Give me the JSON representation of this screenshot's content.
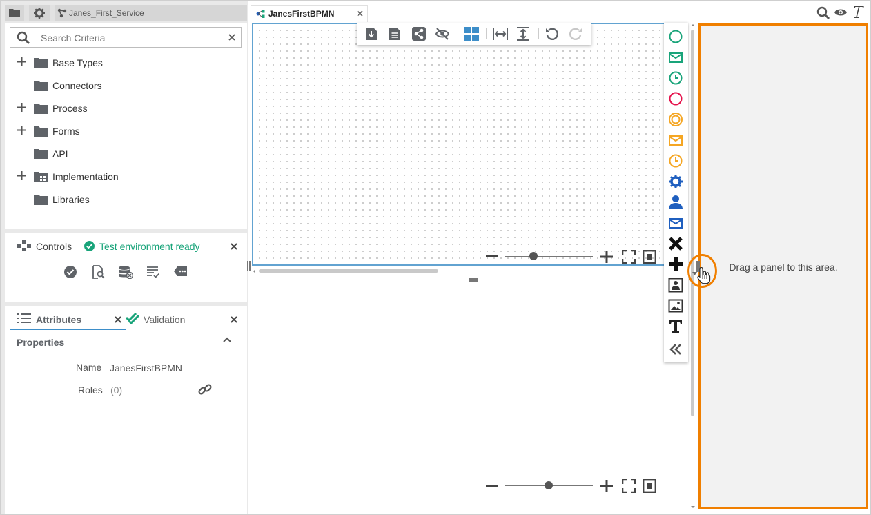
{
  "topbar": {
    "project_name": "Janes_First_Service"
  },
  "search": {
    "placeholder": "Search Criteria"
  },
  "tree": {
    "items": [
      {
        "label": "Base Types",
        "expandable": true
      },
      {
        "label": "Connectors",
        "expandable": false
      },
      {
        "label": "Process",
        "expandable": true
      },
      {
        "label": "Forms",
        "expandable": true
      },
      {
        "label": "API",
        "expandable": false
      },
      {
        "label": "Implementation",
        "expandable": true
      },
      {
        "label": "Libraries",
        "expandable": false
      }
    ]
  },
  "controls": {
    "title": "Controls",
    "status": "Test environment ready"
  },
  "attributes": {
    "tab_attributes": "Attributes",
    "tab_validation": "Validation",
    "section_title": "Properties",
    "name_label": "Name",
    "name_value": "JanesFirstBPMN",
    "roles_label": "Roles",
    "roles_value": "(0)"
  },
  "editor": {
    "tab_label": "JanesFirstBPMN"
  },
  "dropzone": {
    "text": "Drag a panel to this area."
  },
  "zoom": {
    "upper_level": 0.33,
    "lower_level": 0.5
  },
  "colors": {
    "accent_green": "#19a47a",
    "accent_orange": "#f07f00",
    "accent_red": "#e5114b",
    "accent_blue": "#1f5fbf",
    "canvas_border": "#62a3d1"
  }
}
